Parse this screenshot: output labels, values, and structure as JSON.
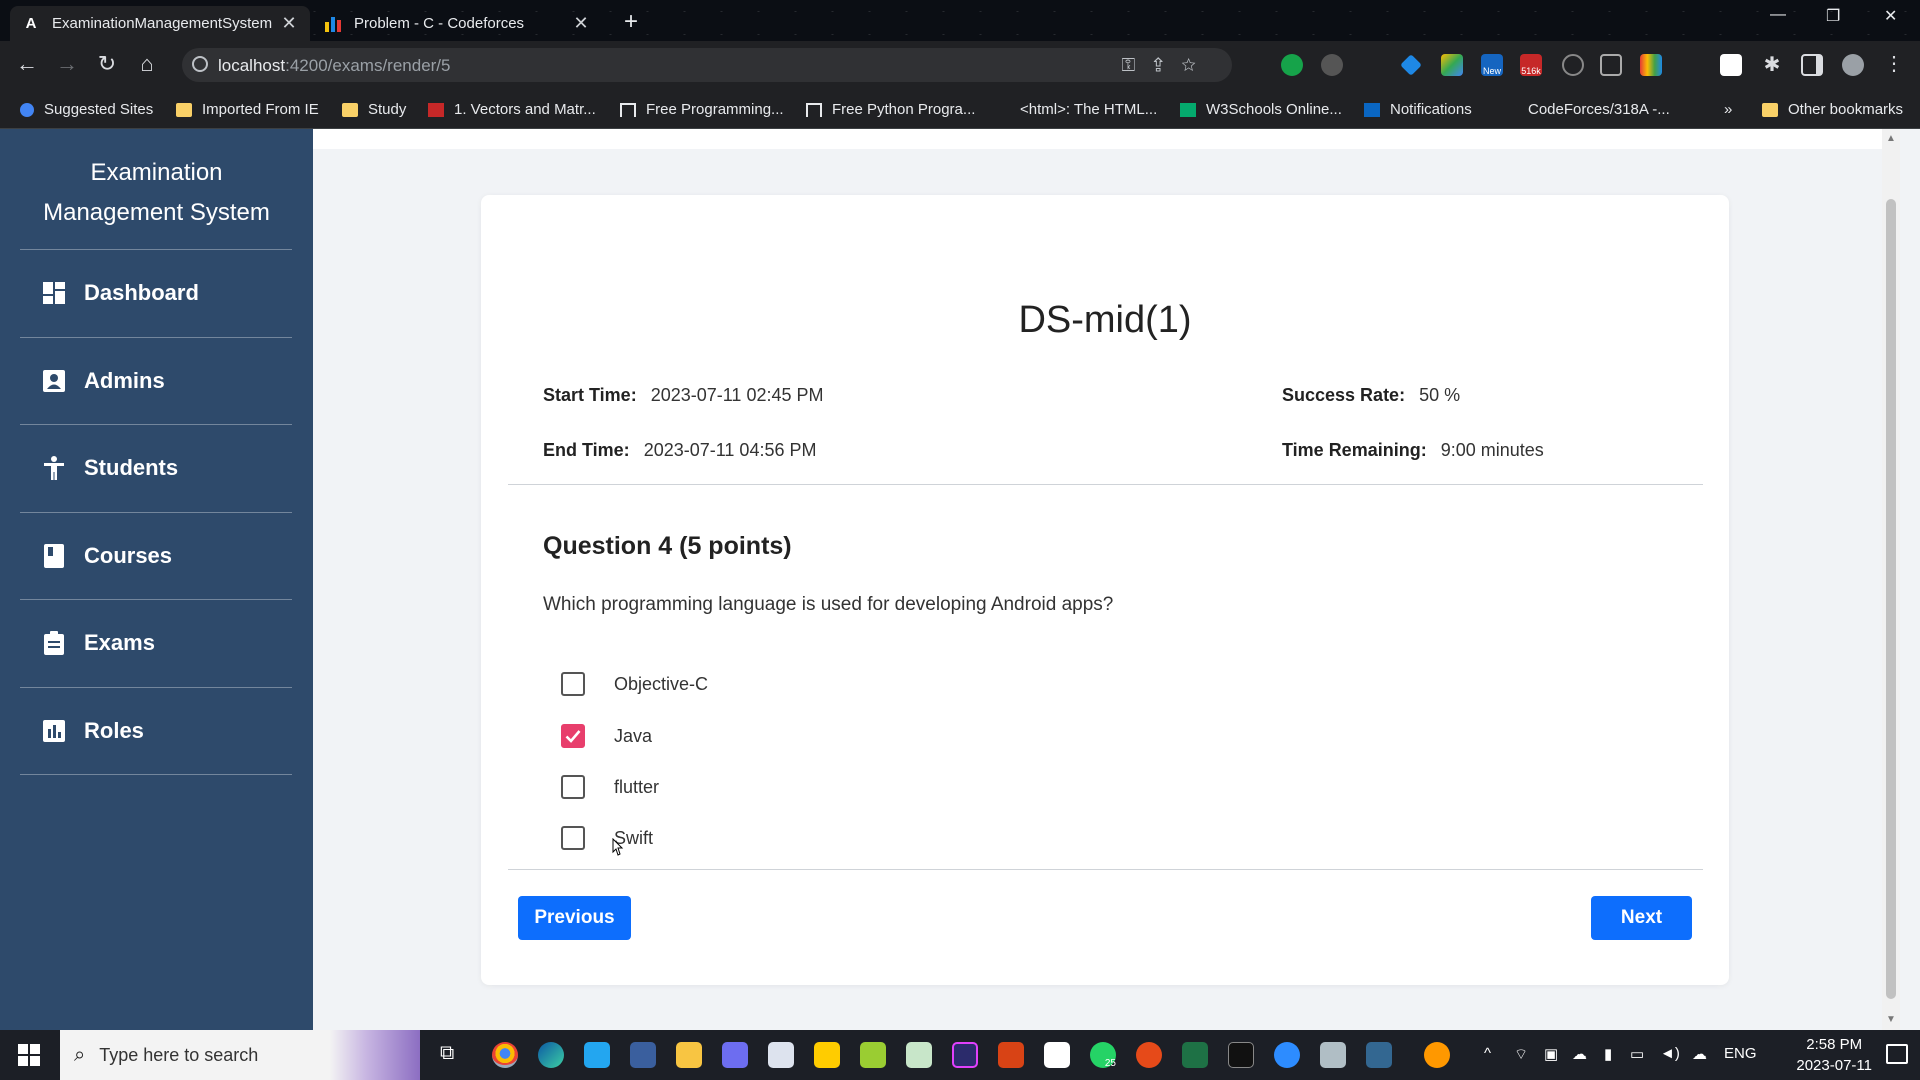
{
  "browser": {
    "tabs": [
      {
        "title": "ExaminationManagementSystem",
        "favicon": "A"
      },
      {
        "title": "Problem - C - Codeforces",
        "favicon": "bar-chart"
      }
    ],
    "url_host": "localhost",
    "url_path": ":4200/exams/render/5",
    "bookmarks": [
      "Suggested Sites",
      "Imported From IE",
      "Study",
      "1. Vectors and Matr...",
      "Free Programming...",
      "Free Python Progra...",
      "<html>: The HTML...",
      "W3Schools Online...",
      "Notifications",
      "CodeForces/318A -...",
      "Other bookmarks"
    ],
    "bookmarks_more": "»",
    "ext_badges": {
      "new": "New",
      "count": "516k"
    }
  },
  "sidebar": {
    "brand_line1": "Examination",
    "brand_line2": "Management System",
    "items": [
      {
        "label": "Dashboard",
        "icon": "dashboard-icon"
      },
      {
        "label": "Admins",
        "icon": "admin-icon"
      },
      {
        "label": "Students",
        "icon": "student-icon"
      },
      {
        "label": "Courses",
        "icon": "book-icon"
      },
      {
        "label": "Exams",
        "icon": "clipboard-icon"
      },
      {
        "label": "Roles",
        "icon": "chart-icon"
      }
    ],
    "bg_color": "#2e4a6b"
  },
  "exam": {
    "title": "DS-mid(1)",
    "start_label": "Start Time:",
    "start_value": "2023-07-11 02:45 PM",
    "end_label": "End Time:",
    "end_value": "2023-07-11 04:56 PM",
    "success_label": "Success Rate:",
    "success_value": "50 %",
    "remaining_label": "Time Remaining:",
    "remaining_value": "9:00 minutes"
  },
  "question": {
    "title": "Question 4 (5 points)",
    "text": "Which programming language is used for developing Android apps?",
    "options": [
      {
        "label": "Objective-C",
        "checked": false
      },
      {
        "label": "Java",
        "checked": true
      },
      {
        "label": "flutter",
        "checked": false
      },
      {
        "label": "Swift",
        "checked": false
      }
    ]
  },
  "buttons": {
    "previous": "Previous",
    "next": "Next"
  },
  "taskbar": {
    "search_placeholder": "Type here to search",
    "lang": "ENG",
    "time": "2:58 PM",
    "date": "2023-07-11",
    "whatsapp_badge": "25"
  },
  "colors": {
    "accent": "#0d6efd",
    "checkbox": "#e83e6c"
  }
}
